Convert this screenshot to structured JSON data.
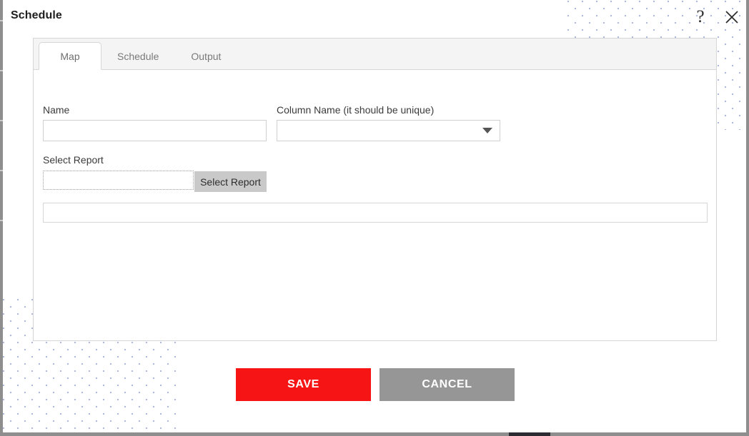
{
  "dialog": {
    "title": "Schedule",
    "help_icon": "question-mark-icon",
    "close_icon": "close-icon"
  },
  "tabs": [
    {
      "label": "Map",
      "active": true
    },
    {
      "label": "Schedule",
      "active": false
    },
    {
      "label": "Output",
      "active": false
    }
  ],
  "form": {
    "name": {
      "label": "Name",
      "value": "",
      "placeholder": ""
    },
    "column_name": {
      "label": "Column Name (it should be unique)",
      "value": "",
      "placeholder": "",
      "chevron_icon": "chevron-down-icon"
    },
    "select_report": {
      "label": "Select Report",
      "value": "",
      "placeholder": "",
      "button_label": "Select Report"
    },
    "report_list": {
      "items": []
    }
  },
  "footer": {
    "save_label": "SAVE",
    "cancel_label": "CANCEL"
  },
  "colors": {
    "save_red": "#f71414",
    "cancel_gray": "#969696",
    "button_gray": "#c9c9c9",
    "tab_strip": "#f4f4f4",
    "border": "#d6d6d6",
    "pattern_dot": "#aab4dd"
  }
}
